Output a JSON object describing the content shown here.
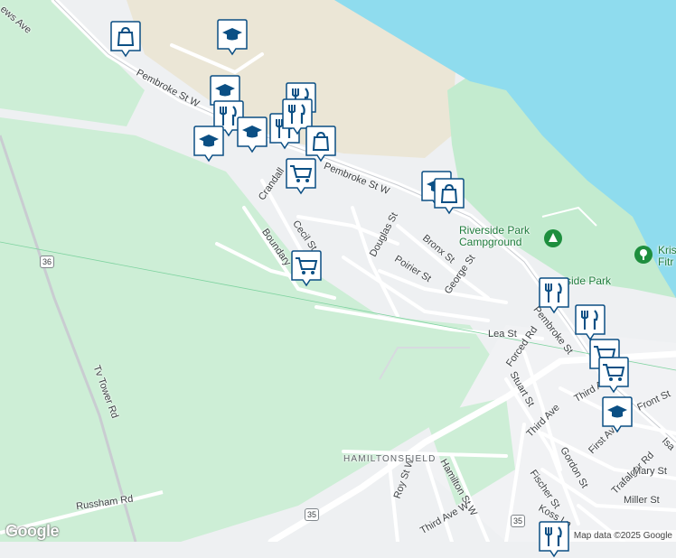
{
  "map": {
    "attribution": "Map data ©2025 Google",
    "logo": "Google",
    "streets": [
      {
        "id": "pembroke-st-w-1",
        "name": "Pembroke St W"
      },
      {
        "id": "pembroke-st-w-2",
        "name": "Pembroke St W"
      },
      {
        "id": "pembroke-st",
        "name": "Pembroke St"
      },
      {
        "id": "crandall",
        "name": "Crandall"
      },
      {
        "id": "cecil-st",
        "name": "Cecil St"
      },
      {
        "id": "boundary",
        "name": "Boundary"
      },
      {
        "id": "douglas-st",
        "name": "Douglas St"
      },
      {
        "id": "bronx-st",
        "name": "Bronx St"
      },
      {
        "id": "poirier-st",
        "name": "Poirier St"
      },
      {
        "id": "george-st",
        "name": "George St"
      },
      {
        "id": "lea-st",
        "name": "Lea St"
      },
      {
        "id": "forced-rd",
        "name": "Forced Rd"
      },
      {
        "id": "stuart-st",
        "name": "Stuart St"
      },
      {
        "id": "third-ave",
        "name": "Third Ave"
      },
      {
        "id": "third-a",
        "name": "Third A"
      },
      {
        "id": "front-st",
        "name": "Front St"
      },
      {
        "id": "first-av",
        "name": "First Av"
      },
      {
        "id": "isa",
        "name": "Isa"
      },
      {
        "id": "gordon-st",
        "name": "Gordon St"
      },
      {
        "id": "trafalgar-rd",
        "name": "Trafalgar Rd"
      },
      {
        "id": "mary-st",
        "name": "Mary St"
      },
      {
        "id": "fischer-st",
        "name": "Fischer St"
      },
      {
        "id": "koss-ln",
        "name": "Koss Ln"
      },
      {
        "id": "miller-st",
        "name": "Miller St"
      },
      {
        "id": "roy-st-w",
        "name": "Roy St W"
      },
      {
        "id": "hamilton-st-w",
        "name": "Hamilton St W"
      },
      {
        "id": "third-ave-w",
        "name": "Third Ave W"
      },
      {
        "id": "tv-tower-rd",
        "name": "Tv Tower Rd"
      },
      {
        "id": "russham-rd",
        "name": "Russham Rd"
      },
      {
        "id": "news-ave",
        "name": "ews Ave"
      }
    ],
    "places": [
      {
        "id": "riverside-campground",
        "name": "Riverside Park\nCampground"
      },
      {
        "id": "riverside-park",
        "name": "rside Park"
      },
      {
        "id": "kris-fit",
        "name": "Kris\nFitr"
      }
    ],
    "district": "HAMILTONSFIELD",
    "route_shields": [
      "36",
      "35",
      "35"
    ],
    "poi_icons": [
      "shopping-bag-icon",
      "school-icon",
      "school-icon",
      "restaurant-icon",
      "restaurant-icon",
      "school-icon",
      "school-icon",
      "restaurant-icon",
      "restaurant-icon",
      "shopping-bag-icon",
      "shopping-cart-icon",
      "school-icon",
      "shopping-bag-icon",
      "shopping-cart-icon",
      "restaurant-icon",
      "restaurant-icon",
      "shopping-cart-icon",
      "shopping-cart-icon",
      "school-icon",
      "restaurant-icon"
    ],
    "colors": {
      "water": "#8fdcee",
      "park": "#c8ecd2",
      "land": "#eef0f2",
      "sand": "#ebe6d6",
      "pin": "#0b4f84"
    }
  }
}
